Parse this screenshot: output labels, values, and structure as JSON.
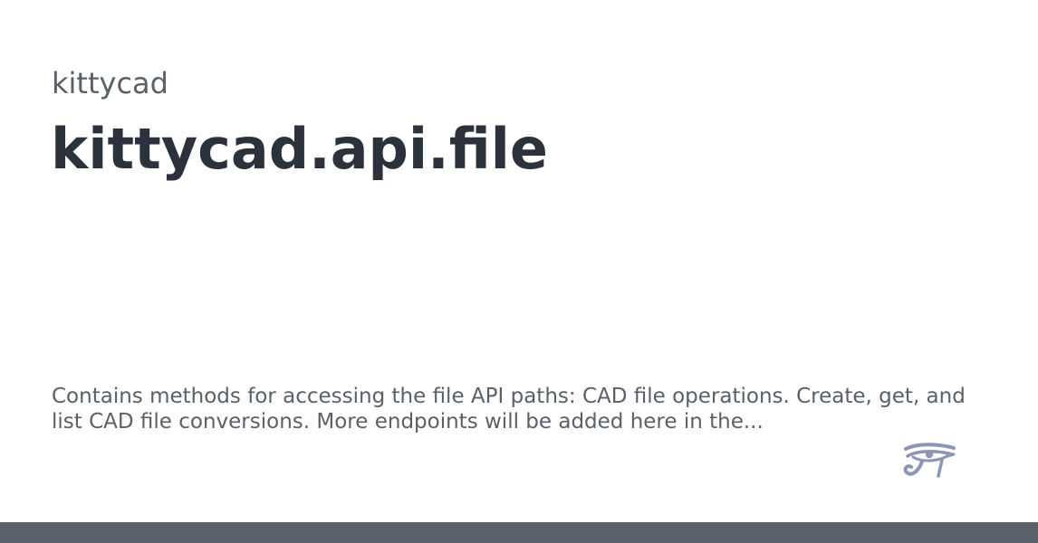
{
  "card": {
    "package_name": "kittycad",
    "module_title": "kittycad.api.file",
    "description": "Contains methods for accessing the file API paths: CAD file operations. Create, get, and list CAD file conversions. More endpoints will be added here in the..."
  },
  "logo": {
    "icon": "eye-of-horus-icon",
    "color": "#8c96b4"
  },
  "colors": {
    "title": "#2b323b",
    "muted_text": "#5a6068",
    "bottom_bar": "#5b616a",
    "background": "#ffffff"
  }
}
